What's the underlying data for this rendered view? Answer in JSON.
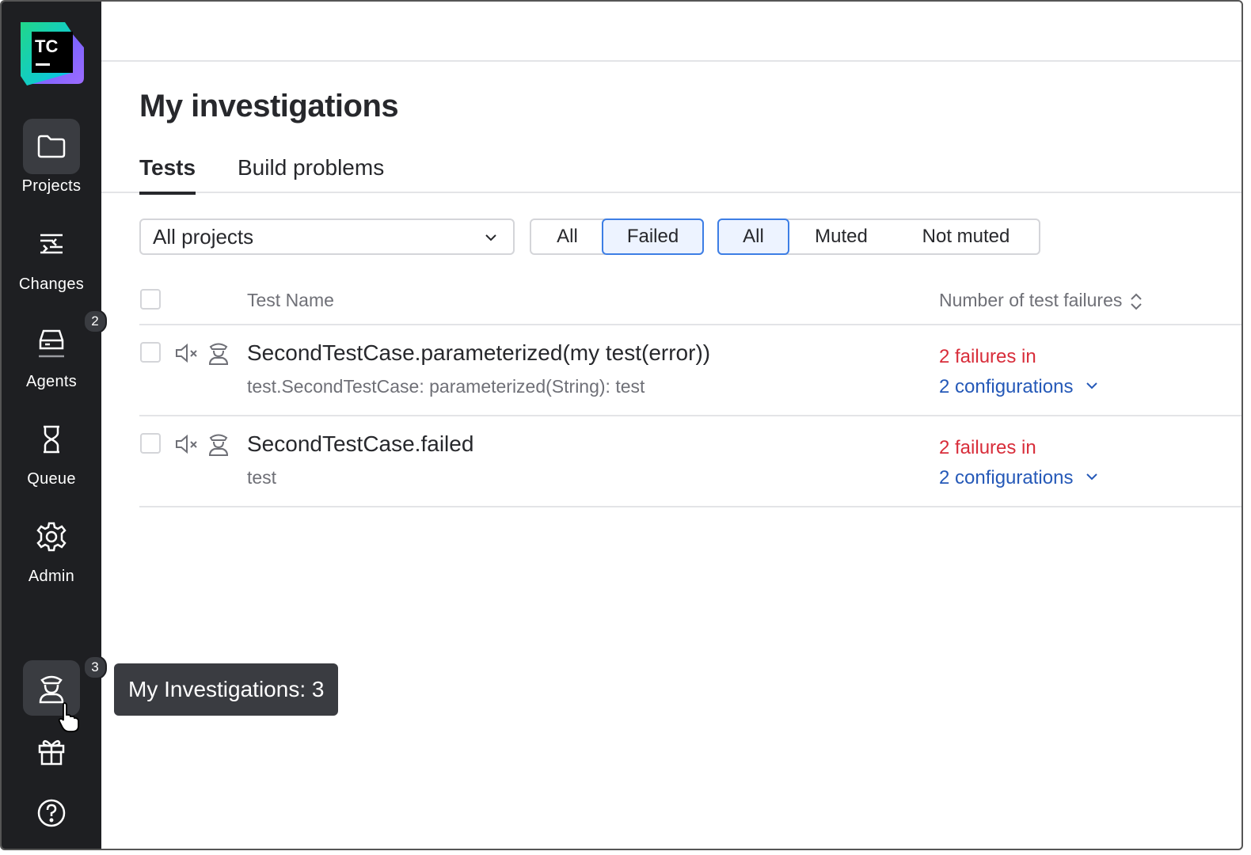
{
  "sidebar": {
    "logo_text": "TC",
    "items": [
      {
        "label": "Projects",
        "icon": "folder-icon"
      },
      {
        "label": "Changes",
        "icon": "changes-icon"
      },
      {
        "label": "Agents",
        "icon": "agents-icon",
        "badge": "2"
      },
      {
        "label": "Queue",
        "icon": "hourglass-icon"
      },
      {
        "label": "Admin",
        "icon": "gear-icon"
      }
    ],
    "investigations_badge": "3",
    "tooltip": "My Investigations: 3"
  },
  "page": {
    "title": "My investigations",
    "tabs": [
      {
        "label": "Tests",
        "active": true
      },
      {
        "label": "Build problems",
        "active": false
      }
    ]
  },
  "filters": {
    "project_select": "All projects",
    "status": [
      "All",
      "Failed"
    ],
    "status_selected": "Failed",
    "mute": [
      "All",
      "Muted",
      "Not muted"
    ],
    "mute_selected": "All"
  },
  "table": {
    "col_test_name": "Test Name",
    "col_failures": "Number of test failures",
    "rows": [
      {
        "name": "SecondTestCase.parameterized(my test(error))",
        "sub": "test.SecondTestCase: parameterized(String): test",
        "failures": "2 failures in",
        "configs": "2 configurations"
      },
      {
        "name": "SecondTestCase.failed",
        "sub": "test",
        "failures": "2 failures in",
        "configs": "2 configurations"
      }
    ]
  },
  "colors": {
    "sidebar_bg": "#1e1f22",
    "accent": "#3d7ee5",
    "failure_red": "#d82d3a",
    "link_blue": "#2559b8"
  }
}
